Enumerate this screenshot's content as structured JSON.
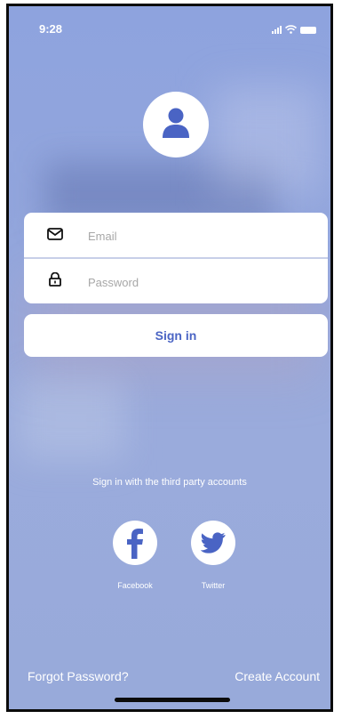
{
  "status_bar": {
    "time": "9:28"
  },
  "login_form": {
    "email_placeholder": "Email",
    "password_placeholder": "Password"
  },
  "sign_in_button": "Sign in",
  "third_party": {
    "prompt": "Sign in with the third party accounts",
    "facebook_label": "Facebook",
    "twitter_label": "Twitter"
  },
  "footer": {
    "forgot_password": "Forgot Password?",
    "create_account": "Create Account"
  },
  "colors": {
    "background": "#93a6dc",
    "button_text": "#4a64c4",
    "icon_fill": "#4a64c4"
  },
  "icons": [
    "user-avatar-icon",
    "email-icon",
    "lock-icon",
    "facebook-icon",
    "twitter-icon",
    "signal-icon",
    "wifi-icon",
    "battery-icon"
  ]
}
